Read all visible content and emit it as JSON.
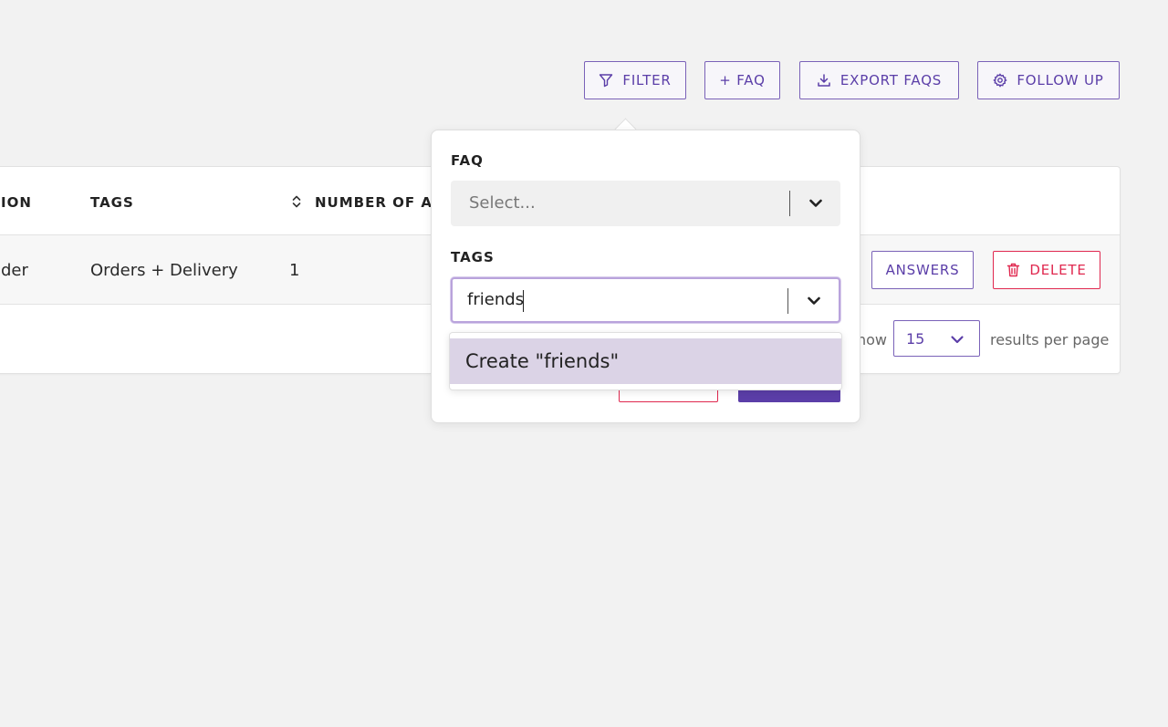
{
  "toolbar": {
    "filter_label": "FILTER",
    "add_faq_label": "+ FAQ",
    "export_label": "EXPORT FAQS",
    "follow_up_label": "FOLLOW UP"
  },
  "table": {
    "columns": [
      "ION",
      "TAGS",
      "NUMBER OF AN"
    ],
    "rows": [
      {
        "question": "der",
        "tags": "Orders + Delivery",
        "answers": "1"
      }
    ],
    "answers_button": "ANSWERS",
    "delete_button": "DELETE"
  },
  "pagination": {
    "show_label": "how",
    "per_page_value": "15",
    "results_label": "results per page"
  },
  "filter_popover": {
    "faq_label": "FAQ",
    "faq_placeholder": "Select...",
    "tags_label": "TAGS",
    "tags_input_value": "friends",
    "create_option": "Create \"friends\""
  },
  "colors": {
    "accent": "#5b3ea8",
    "danger": "#e0284f",
    "highlight": "#dbd3e6",
    "background": "#f2f2f2"
  }
}
